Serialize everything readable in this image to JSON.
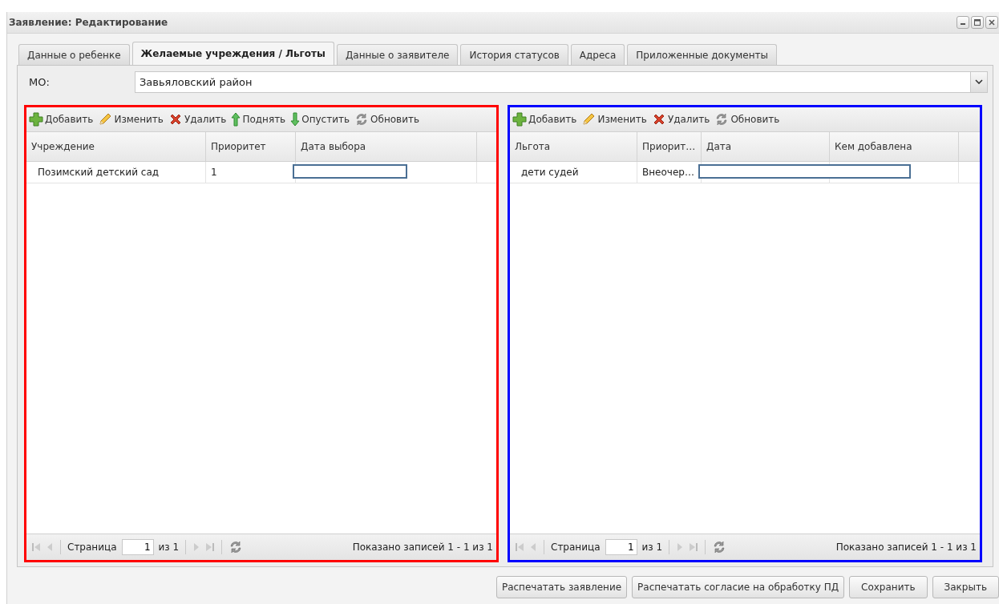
{
  "window": {
    "title": "Заявление: Редактирование"
  },
  "tabs": [
    {
      "label": "Данные о ребенке",
      "selected": false
    },
    {
      "label": "Желаемые учреждения / Льготы",
      "selected": true
    },
    {
      "label": "Данные о заявителе",
      "selected": false
    },
    {
      "label": "История статусов",
      "selected": false
    },
    {
      "label": "Адреса",
      "selected": false
    },
    {
      "label": "Приложенные документы",
      "selected": false
    }
  ],
  "mo": {
    "label": "МО:",
    "value": "Завьяловский район"
  },
  "panels": [
    {
      "color": "#ff0000",
      "toolbar": [
        {
          "kind": "add",
          "label": "Добавить"
        },
        {
          "kind": "edit",
          "label": "Изменить"
        },
        {
          "kind": "delete",
          "label": "Удалить"
        },
        {
          "kind": "up",
          "label": "Поднять"
        },
        {
          "kind": "down",
          "label": "Опустить"
        },
        {
          "kind": "refresh",
          "label": "Обновить"
        }
      ],
      "columns": [
        "Учреждение",
        "Приоритет",
        "Дата выбора"
      ],
      "rows": [
        {
          "cells": [
            {
              "kind": "text",
              "text": "Позимский детский сад"
            },
            {
              "kind": "text",
              "text": "1"
            },
            {
              "kind": "editor"
            }
          ]
        }
      ],
      "pager": {
        "page_label": "Страница",
        "page": "1",
        "of": "из 1",
        "summary": "Показано записей 1 - 1 из 1"
      }
    },
    {
      "color": "#0000ff",
      "toolbar": [
        {
          "kind": "add",
          "label": "Добавить"
        },
        {
          "kind": "edit",
          "label": "Изменить"
        },
        {
          "kind": "delete",
          "label": "Удалить"
        },
        {
          "kind": "refresh",
          "label": "Обновить"
        }
      ],
      "columns": [
        "Льгота",
        "Приорит…",
        "Дата",
        "Кем добавлена"
      ],
      "rows": [
        {
          "cells": [
            {
              "kind": "text",
              "text": "дети судей"
            },
            {
              "kind": "text",
              "text": "Внеочер…"
            },
            {
              "kind": "editor"
            },
            {
              "kind": "text",
              "text": ""
            }
          ]
        }
      ],
      "pager": {
        "page_label": "Страница",
        "page": "1",
        "of": "из 1",
        "summary": "Показано записей 1 - 1 из 1"
      }
    }
  ],
  "buttons": [
    "Распечатать заявление",
    "Распечатать согласие на обработку ПД",
    "Сохранить",
    "Закрыть"
  ]
}
